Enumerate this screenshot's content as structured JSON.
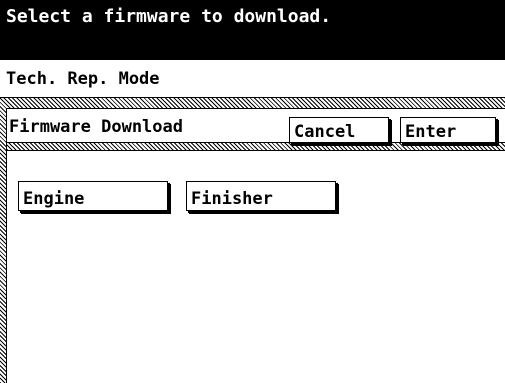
{
  "message": "Select a firmware to download.",
  "mode": "Tech. Rep. Mode",
  "screen_title": "Firmware Download",
  "buttons": {
    "cancel": "Cancel",
    "enter": "Enter",
    "engine": "Engine",
    "finisher": "Finisher"
  },
  "colors": {
    "background": "#ffffff",
    "foreground": "#000000"
  }
}
